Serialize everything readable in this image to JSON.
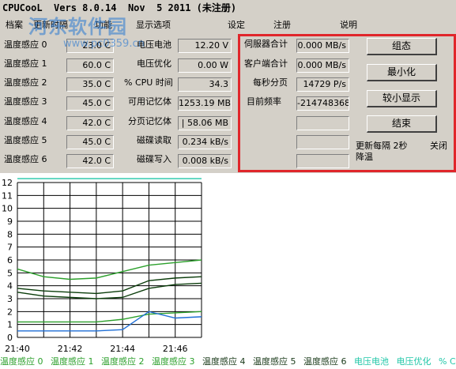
{
  "window": {
    "title": "CPUCooL  Vers 8.0.14  Nov  5 2011 (未注册)"
  },
  "watermark": {
    "text": "河东软件园",
    "url": "www.pc0359.cn"
  },
  "menu": [
    "档案",
    "更新时隔",
    "功能",
    "显示选项",
    "设定",
    "注册",
    "说明"
  ],
  "temps": [
    {
      "label": "温度感应 0",
      "value": "23.0 C"
    },
    {
      "label": "温度感应 1",
      "value": "60.0 C"
    },
    {
      "label": "温度感应 2",
      "value": "35.0 C"
    },
    {
      "label": "温度感应 3",
      "value": "45.0 C"
    },
    {
      "label": "温度感应 4",
      "value": "42.0 C"
    },
    {
      "label": "温度感应 5",
      "value": "45.0 C"
    },
    {
      "label": "温度感应 6",
      "value": "42.0 C"
    }
  ],
  "system": [
    {
      "label": "电压电池",
      "value": "12.20 V"
    },
    {
      "label": "电压优化",
      "value": "0.00 W"
    },
    {
      "label": "% CPU 时间",
      "value": "34.3"
    },
    {
      "label": "可用记忆体",
      "value": "1253.19 MB"
    },
    {
      "label": "分页记忆体",
      "value": "| 58.06 MB"
    },
    {
      "label": "磁碟读取",
      "value": "0.234 kB/s"
    },
    {
      "label": "磁碟写入",
      "value": "0.008 kB/s"
    }
  ],
  "network": [
    {
      "label": "伺服器合计",
      "value": "0.000 MB/s"
    },
    {
      "label": "客户端合计",
      "value": "0.000 MB/s"
    },
    {
      "label": "每秒分页",
      "value": "14729 P/s"
    },
    {
      "label": "目前频率",
      "value": "-214748368.0"
    },
    {
      "label": "",
      "value": ""
    },
    {
      "label": "",
      "value": ""
    },
    {
      "label": "",
      "value": ""
    }
  ],
  "buttons": {
    "configure": "组态",
    "minimize": "最小化",
    "small_view": "较小显示",
    "exit": "结束"
  },
  "status": {
    "update_text": "更新每隔 2秒",
    "close": "关闭",
    "cool": "降温"
  },
  "colors": {
    "frame": "#e0262b",
    "grid": "#000000",
    "series_green": "#2ca02c",
    "series_dark": "#0b3d0b",
    "series_blue": "#1f6fd6",
    "series_cyan": "#21c7a8"
  },
  "chart_data": {
    "type": "line",
    "ylim": [
      0,
      12
    ],
    "yticks": [
      "0",
      "1",
      "2",
      "3",
      "4",
      "5",
      "6",
      "7",
      "8",
      "9",
      "10",
      "11",
      "12"
    ],
    "x": [
      "21:40",
      "21:41",
      "21:42",
      "21:43",
      "21:44",
      "21:45",
      "21:46",
      "21:47"
    ],
    "xtick_labels": [
      "21:40",
      "21:42",
      "21:44",
      "21:46"
    ],
    "series": [
      {
        "values": [
          5.3,
          4.7,
          4.5,
          4.6,
          5.1,
          5.6,
          5.8,
          6.0
        ]
      },
      {
        "values": [
          3.8,
          3.6,
          3.5,
          3.4,
          3.6,
          4.4,
          4.6,
          4.7
        ]
      },
      {
        "values": [
          3.5,
          3.2,
          3.1,
          3.0,
          3.1,
          3.8,
          4.1,
          4.2
        ]
      },
      {
        "values": [
          1.2,
          1.2,
          1.2,
          1.2,
          1.4,
          1.8,
          1.9,
          2.0
        ]
      },
      {
        "values": [
          0.5,
          0.5,
          0.5,
          0.5,
          0.6,
          2.0,
          1.5,
          1.6
        ]
      },
      {
        "values": [
          12.3,
          12.3,
          12.3,
          12.3,
          12.3,
          12.3,
          12.3,
          12.3
        ]
      }
    ]
  },
  "legend": [
    "温度感应 0",
    "温度感应 1",
    "温度感应 2",
    "温度感应 3",
    "温度感应 4",
    "温度感应 5",
    "温度感应 6",
    "电压电池",
    "电压优化",
    "% CPU"
  ]
}
